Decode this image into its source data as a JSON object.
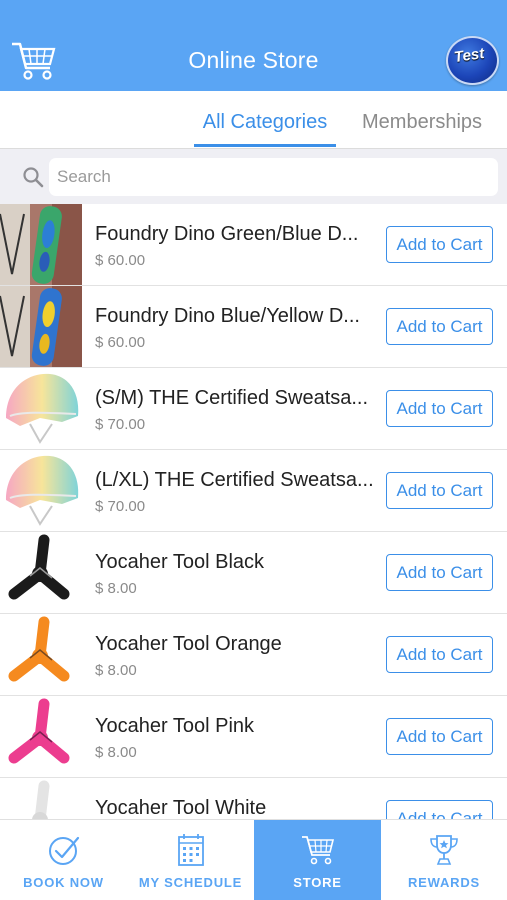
{
  "header": {
    "title": "Online Store",
    "avatar_text": "Test",
    "background": "#5aa5f4",
    "left_icon": "cart-icon"
  },
  "tabs": [
    {
      "label": "All Categories",
      "active": true
    },
    {
      "label": "Memberships",
      "active": false
    }
  ],
  "search": {
    "placeholder": "Search",
    "value": ""
  },
  "products": [
    {
      "name": "Foundry Dino Green/Blue D...",
      "price": "$ 60.00",
      "button": "Add to Cart",
      "image": "skateboard-deck-green"
    },
    {
      "name": "Foundry Dino Blue/Yellow D...",
      "price": "$ 60.00",
      "button": "Add to Cart",
      "image": "skateboard-deck-blue"
    },
    {
      "name": "(S/M) THE Certified Sweatsa...",
      "price": "$ 70.00",
      "button": "Add to Cart",
      "image": "helmet-pastel"
    },
    {
      "name": "(L/XL) THE Certified Sweatsa...",
      "price": "$ 70.00",
      "button": "Add to Cart",
      "image": "helmet-pastel"
    },
    {
      "name": "Yocaher Tool Black",
      "price": "$ 8.00",
      "button": "Add to Cart",
      "image": "tool-black"
    },
    {
      "name": "Yocaher Tool Orange",
      "price": "$ 8.00",
      "button": "Add to Cart",
      "image": "tool-orange"
    },
    {
      "name": "Yocaher Tool Pink",
      "price": "$ 8.00",
      "button": "Add to Cart",
      "image": "tool-pink"
    },
    {
      "name": "Yocaher Tool White",
      "price": "",
      "button": "Add to Cart",
      "image": "tool-white"
    }
  ],
  "tabbar": [
    {
      "label": "BOOK NOW",
      "icon": "check-circle-icon",
      "active": false
    },
    {
      "label": "MY SCHEDULE",
      "icon": "calendar-icon",
      "active": false
    },
    {
      "label": "STORE",
      "icon": "cart-icon",
      "active": true
    },
    {
      "label": "REWARDS",
      "icon": "trophy-icon",
      "active": false
    }
  ],
  "colors": {
    "accent": "#3b8fe8",
    "header": "#5aa5f4",
    "tool_black": "#1b1b1b",
    "tool_orange": "#f58a1f",
    "tool_pink": "#ec3d8f",
    "tool_white": "#e8e8e8"
  }
}
